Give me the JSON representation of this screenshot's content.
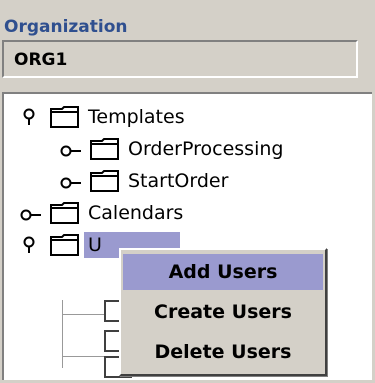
{
  "panel": {
    "title": "Organization"
  },
  "organization": {
    "value": "ORG1"
  },
  "tree": {
    "nodes": [
      {
        "label": "Templates",
        "expanded": true
      },
      {
        "label": "OrderProcessing",
        "expanded": false
      },
      {
        "label": "StartOrder",
        "expanded": false
      },
      {
        "label": "Calendars",
        "expanded": false
      },
      {
        "label": "U",
        "expanded": true
      }
    ]
  },
  "context_menu": {
    "items": [
      {
        "label": "Add Users"
      },
      {
        "label": "Create Users"
      },
      {
        "label": "Delete Users"
      }
    ],
    "highlight_color": "#9a9acf"
  },
  "colors": {
    "panel_title": "#2f4f8f",
    "background": "#d4d0c8",
    "tree_background": "#ffffff"
  }
}
